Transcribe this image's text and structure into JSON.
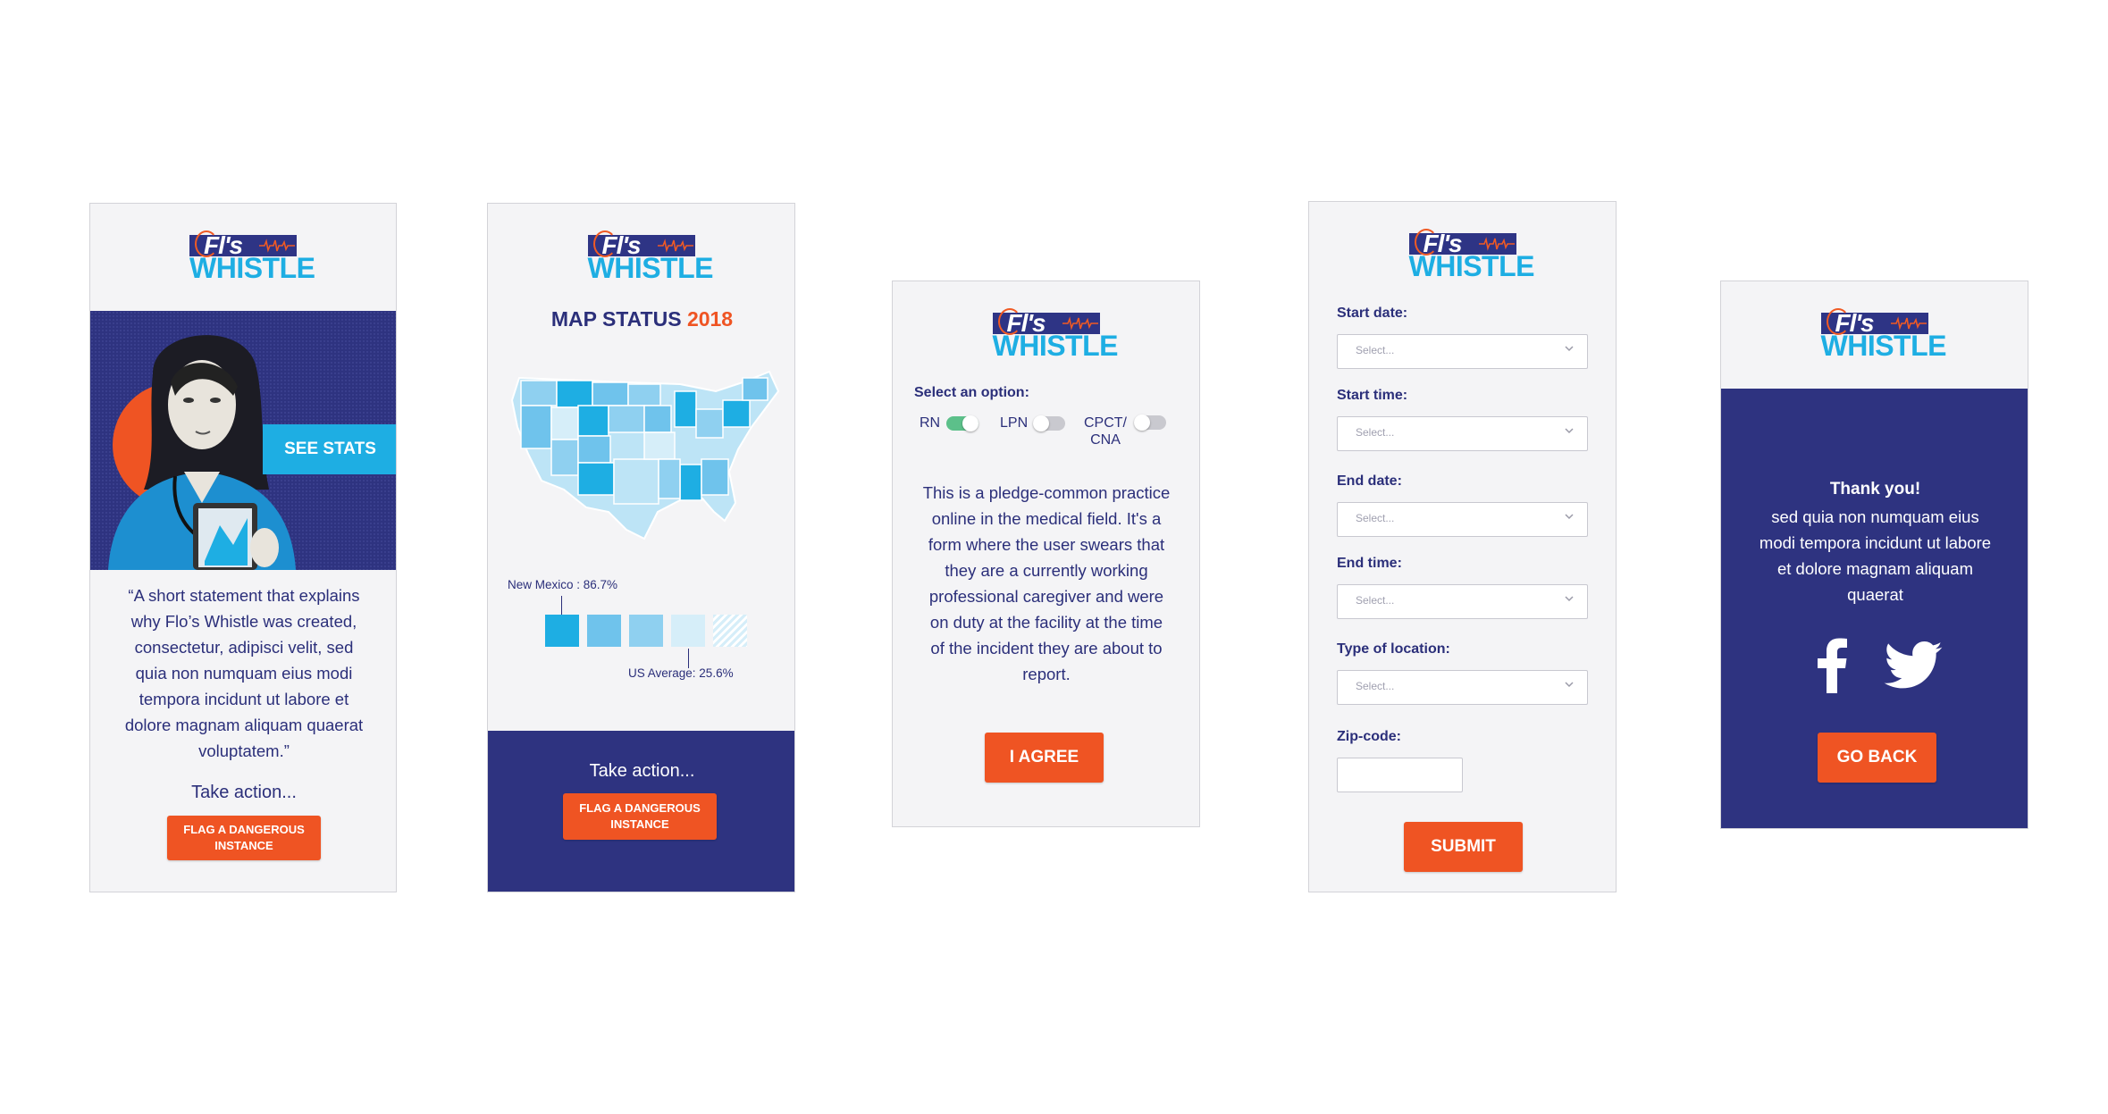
{
  "brand": {
    "logo_top": "Fl's",
    "logo_bottom": "WHISTLE"
  },
  "colors": {
    "navy": "#2e3380",
    "orange": "#ef5423",
    "cyan": "#1eaee3",
    "panel": "#f4f4f6"
  },
  "screen1": {
    "see_stats": "SEE STATS",
    "quote": "“A short statement that explains why Flo’s Whistle was created, consectetur, adipisci velit, sed quia non numquam eius modi tempora incidunt ut labore et dolore magnam aliquam quaerat voluptatem.”",
    "take_action": "Take action...",
    "flag_line1": "FLAG A DANGEROUS",
    "flag_line2": "INSTANCE"
  },
  "screen2": {
    "title": "MAP STATUS",
    "year": "2018",
    "nm_label": "New Mexico : 86.7%",
    "us_label": "US Average: 25.6%",
    "take_action": "Take action...",
    "flag_line1": "FLAG A DANGEROUS",
    "flag_line2": "INSTANCE"
  },
  "screen3": {
    "select_label": "Select an option:",
    "options": [
      {
        "label": "RN",
        "on": true
      },
      {
        "label": "LPN",
        "on": false
      },
      {
        "label": "CPCT/ CNA",
        "on": false
      }
    ],
    "pledge": "This is a pledge-common practice online in the medical field. It's a form where the user swears that they are a currently working professional caregiver and were on duty at the facility at the time of the incident they are about to report.",
    "agree": "I AGREE"
  },
  "screen4": {
    "start_date": "Start date:",
    "start_time": "Start time:",
    "end_date": "End date:",
    "end_time": "End time:",
    "location_type": "Type of location:",
    "zip": "Zip-code:",
    "placeholder": "Select...",
    "submit": "SUBMIT"
  },
  "screen5": {
    "thanks": "Thank you!",
    "message": "sed quia non numquam eius modi tempora incidunt ut labore et dolore magnam aliquam quaerat",
    "facebook_icon": "facebook-icon",
    "twitter_icon": "twitter-icon",
    "go_back": "GO BACK"
  }
}
